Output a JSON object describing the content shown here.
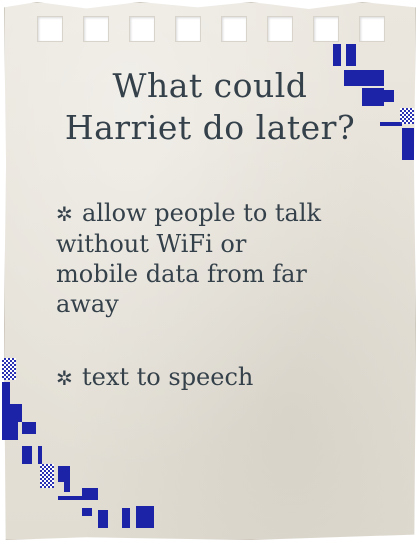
{
  "note": {
    "title_line1": "What could",
    "title_line2": "Harriet do later?",
    "bullet_symbol": "✲",
    "items": [
      {
        "lines": [
          "allow people to talk",
          "without WiFi or",
          "mobile data from far",
          "away"
        ]
      },
      {
        "lines": [
          "text to speech"
        ]
      }
    ]
  },
  "colors": {
    "paper": "#e6e2d9",
    "ink": "#35414a",
    "pixel_accent": "#1c23a6"
  }
}
